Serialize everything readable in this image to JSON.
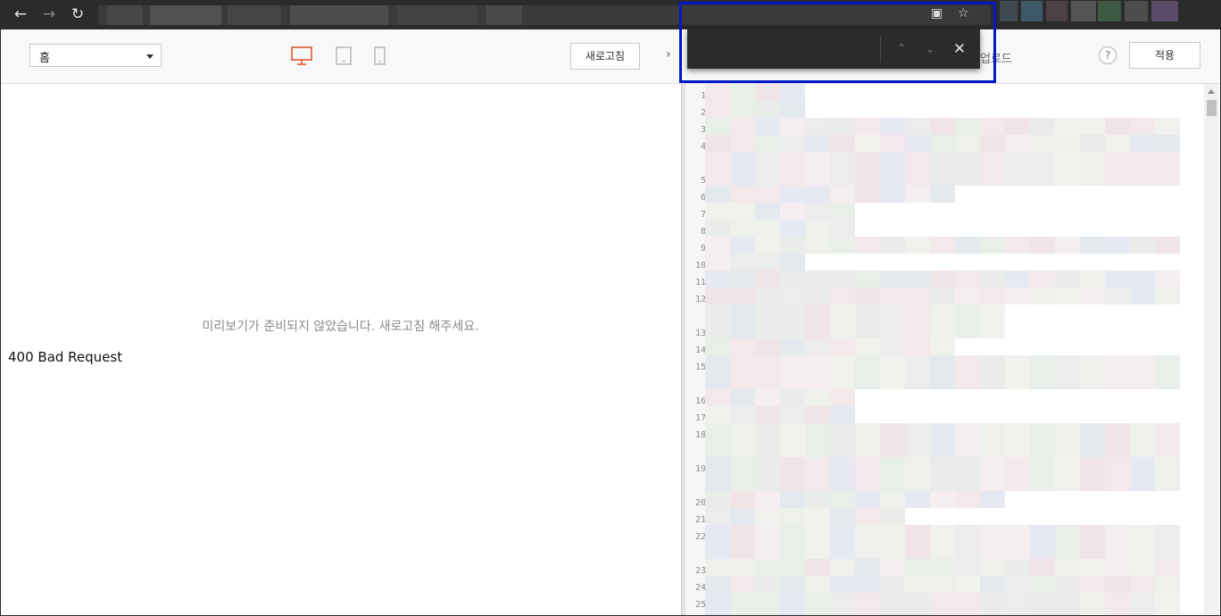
{
  "toolbar": {
    "page_select": "홈",
    "refresh_label": "새로고침",
    "apply_label": "적용",
    "upload_label": "업로드",
    "help_label": "?"
  },
  "preview": {
    "message": "미리보기가 준비되지 않았습니다. 새로고침 해주세요.",
    "error": "400 Bad Request"
  },
  "code": {
    "line_numbers": [
      "1",
      "2",
      "3",
      "4",
      "5",
      "6",
      "7",
      "8",
      "9",
      "10",
      "11",
      "12",
      "13",
      "14",
      "15",
      "16",
      "17",
      "18",
      "19",
      "20",
      "21",
      "22",
      "23",
      "24",
      "25"
    ]
  },
  "colors": {
    "accent": "#e05a2b",
    "highlight_border": "#0018c8"
  },
  "icons": {
    "back": "arrow-left",
    "forward": "arrow-right",
    "reload": "refresh",
    "desktop": "monitor",
    "tablet": "tablet",
    "mobile": "phone",
    "find_up": "chevron-up",
    "find_down": "chevron-down",
    "find_close": "close"
  }
}
